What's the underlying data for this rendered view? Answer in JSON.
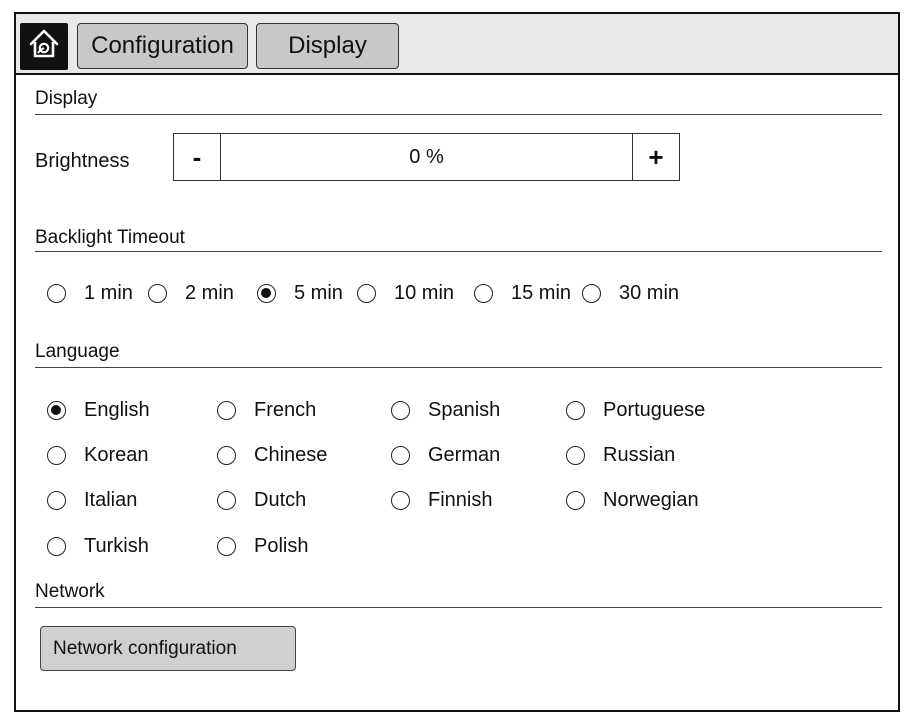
{
  "breadcrumb": {
    "items": [
      "Configuration",
      "Display"
    ]
  },
  "icons": {
    "home": "home-icon"
  },
  "display_section": {
    "title": "Display",
    "brightness": {
      "label": "Brightness",
      "minus": "-",
      "value": "0 %",
      "plus": "+"
    }
  },
  "backlight_section": {
    "title": "Backlight Timeout",
    "options": [
      "1 min",
      "2 min",
      "5 min",
      "10 min",
      "15 min",
      "30 min"
    ],
    "selected": "5 min"
  },
  "language_section": {
    "title": "Language",
    "options": [
      "English",
      "French",
      "Spanish",
      "Portuguese",
      "Korean",
      "Chinese",
      "German",
      "Russian",
      "Italian",
      "Dutch",
      "Finnish",
      "Norwegian",
      "Turkish",
      "Polish"
    ],
    "selected": "English"
  },
  "network_section": {
    "title": "Network",
    "button_label": "Network configuration"
  }
}
